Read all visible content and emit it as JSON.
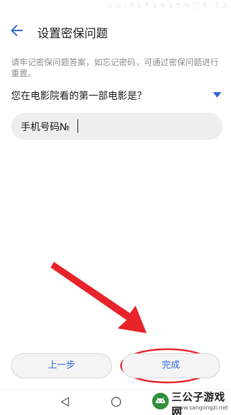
{
  "status_bar": {
    "text": "⊙ ⊙ ⁝ 0 0 ↑ 1 ⊕ 1 5 % ▢ 5 : 5 3"
  },
  "header": {
    "back_icon": "arrow-left-icon",
    "title": "设置密保问题"
  },
  "hint": {
    "text": "请牢记密保问题答案，如忘记密码，可通过密保问题进行重置。"
  },
  "question": {
    "selected": "您在电影院看的第一部电影是？",
    "dropdown_icon": "triangle-down-icon"
  },
  "answer": {
    "value": "手机号码№"
  },
  "buttons": {
    "prev_label": "上一步",
    "done_label": "完成"
  },
  "nav": {
    "back_icon": "triangle-back-icon",
    "home_icon": "circle-home-icon"
  },
  "watermark": {
    "title": "三公子游戏网",
    "url": "www.sangongzi.net"
  },
  "colors": {
    "accent": "#2b67d6",
    "annotation": "#e8242b",
    "field_bg": "#eeeeee"
  }
}
